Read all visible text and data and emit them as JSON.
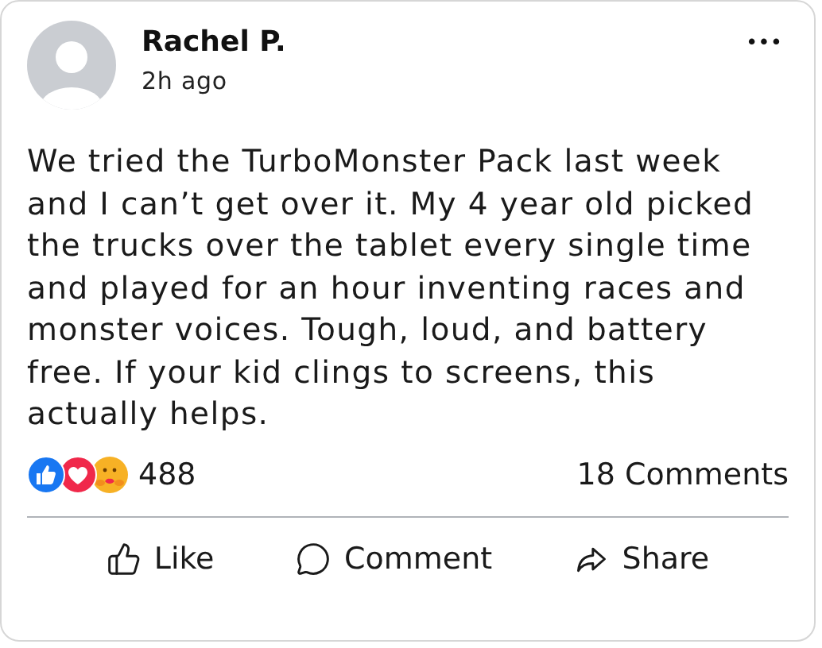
{
  "post": {
    "author": "Rachel P.",
    "time": "2h ago",
    "more": "•••",
    "body": "We tried the TurboMonster Pack last week and I can’t get over it. My 4 year old picked the trucks over the tablet every single time and played for an hour inventing races and monster voices. Tough, loud, and battery free. If your kid clings to screens, this actually helps."
  },
  "reactions": {
    "items": [
      {
        "kind": "like"
      },
      {
        "kind": "love"
      },
      {
        "kind": "care"
      }
    ],
    "count": "488",
    "comments": "18 Comments"
  },
  "actions": [
    {
      "kind": "like",
      "label": "Like"
    },
    {
      "kind": "comment",
      "label": "Comment"
    },
    {
      "kind": "share",
      "label": "Share"
    }
  ]
}
